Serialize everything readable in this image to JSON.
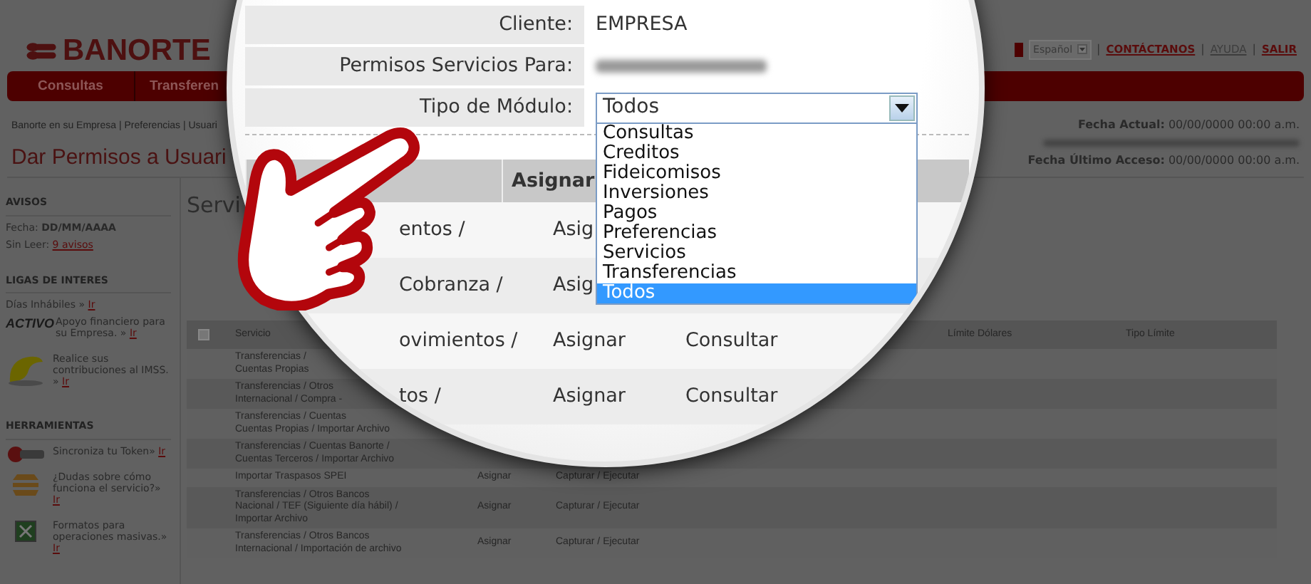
{
  "header": {
    "logo": "BANORTE",
    "language": "Español",
    "links": [
      {
        "kind": "separator",
        "label": "|"
      },
      {
        "kind": "link",
        "label": "CONTÁCTANOS",
        "highlighted": true
      },
      {
        "kind": "separator",
        "label": "|"
      },
      {
        "kind": "link",
        "label": "AYUDA",
        "highlighted": false
      },
      {
        "kind": "separator",
        "label": "|"
      },
      {
        "kind": "link",
        "label": "SALIR",
        "highlighted": true
      }
    ]
  },
  "nav_tabs": [
    {
      "label": "Consultas"
    },
    {
      "label": "Transferen"
    }
  ],
  "breadcrumb": "Banorte en su Empresa | Preferencias | Usuari",
  "page_title": "Dar Permisos a Usuari",
  "fecha_actual": {
    "label": "Fecha Actual:",
    "value": "00/00/0000 00:00 a.m."
  },
  "ultimo_acceso": {
    "label": "Fecha Último Acceso:",
    "value": "00/00/0000 00:00 a.m."
  },
  "sidebar": [
    {
      "title": "AVISOS",
      "items": [
        {
          "kind": "text",
          "text": "Fecha: **DD/MM/AAAA**"
        },
        {
          "kind": "text",
          "text": "Sin Leer:",
          "link": "9 avisos"
        }
      ]
    },
    {
      "title": "LIGAS DE INTERES",
      "items": [
        {
          "kind": "text",
          "text": "Días Inhábiles »",
          "link": "Ir"
        },
        {
          "kind": "logo",
          "logo_text": "ACTIVO",
          "text": "Apoyo financiero para su Empresa. »",
          "link": "Ir"
        },
        {
          "kind": "swoosh",
          "text": "Realice sus contribuciones al IMSS. »",
          "link": "Ir"
        }
      ]
    },
    {
      "title": "HERRAMIENTAS",
      "items": [
        {
          "kind": "token",
          "text": "Sincroniza tu Token»",
          "link": "Ir"
        },
        {
          "kind": "stack",
          "text": "¿Dudas sobre cómo funciona el servicio?»",
          "link": "Ir"
        },
        {
          "kind": "sheet",
          "text": "Formatos para operaciones masivas.»",
          "link": "Ir"
        }
      ]
    }
  ],
  "main": {
    "heading": "Servi",
    "table": {
      "select_all_checked": false,
      "header": {
        "service": "Servicio",
        "limit_usd": "Límite Dólares",
        "limit_type": "Tipo Límite"
      },
      "rows": [
        {
          "service": "Transferencias /\nCuentas Propias"
        },
        {
          "service": "Transferencias / Otros\nInternacional / Compra -"
        },
        {
          "service": "Transferencias / Cuentas\nCuentas Propias / Importar Archivo"
        },
        {
          "service": "Transferencias / Cuentas Banorte /\nCuentas Terceros / Importar Archivo"
        },
        {
          "service": "Importar Traspasos SPEI",
          "assign": "Asignar",
          "permission": "Capturar / Ejecutar"
        },
        {
          "service": "Transferencias / Otros Bancos\nNacional / TEF (Siguiente día hábil) /\nImportar Archivo",
          "assign": "Asignar",
          "permission": "Capturar / Ejecutar"
        },
        {
          "service": "Transferencias / Otros Bancos\nInternacional / Importación de archivo",
          "assign": "Asignar",
          "permission": "Capturar / Ejecutar"
        }
      ]
    }
  },
  "magnifier": {
    "form": [
      {
        "kind": "text",
        "label": "Cliente:",
        "value": "EMPRESA"
      },
      {
        "kind": "blurred",
        "label": "Permisos Servicios Para:"
      },
      {
        "kind": "select",
        "label": "Tipo de Módulo:",
        "value": "Todos"
      }
    ],
    "dropdown_options": [
      {
        "label": "Consultas",
        "selected": false
      },
      {
        "label": "Creditos",
        "selected": false
      },
      {
        "label": "Fideicomisos",
        "selected": false
      },
      {
        "label": "Inversiones",
        "selected": false
      },
      {
        "label": "Pagos",
        "selected": false
      },
      {
        "label": "Preferencias",
        "selected": false
      },
      {
        "label": "Servicios",
        "selected": false
      },
      {
        "label": "Transferencias",
        "selected": false
      },
      {
        "label": "Todos",
        "selected": true
      }
    ],
    "table": {
      "header": "Asignar",
      "rows": [
        {
          "service": "entos /",
          "assign": "Asig"
        },
        {
          "service": "Cobranza /",
          "assign": "Asig"
        },
        {
          "service": "ovimientos /",
          "assign": "Asignar",
          "permission": "Consultar"
        },
        {
          "service": "tos /",
          "assign": "Asignar",
          "permission": "Consultar"
        }
      ]
    }
  }
}
